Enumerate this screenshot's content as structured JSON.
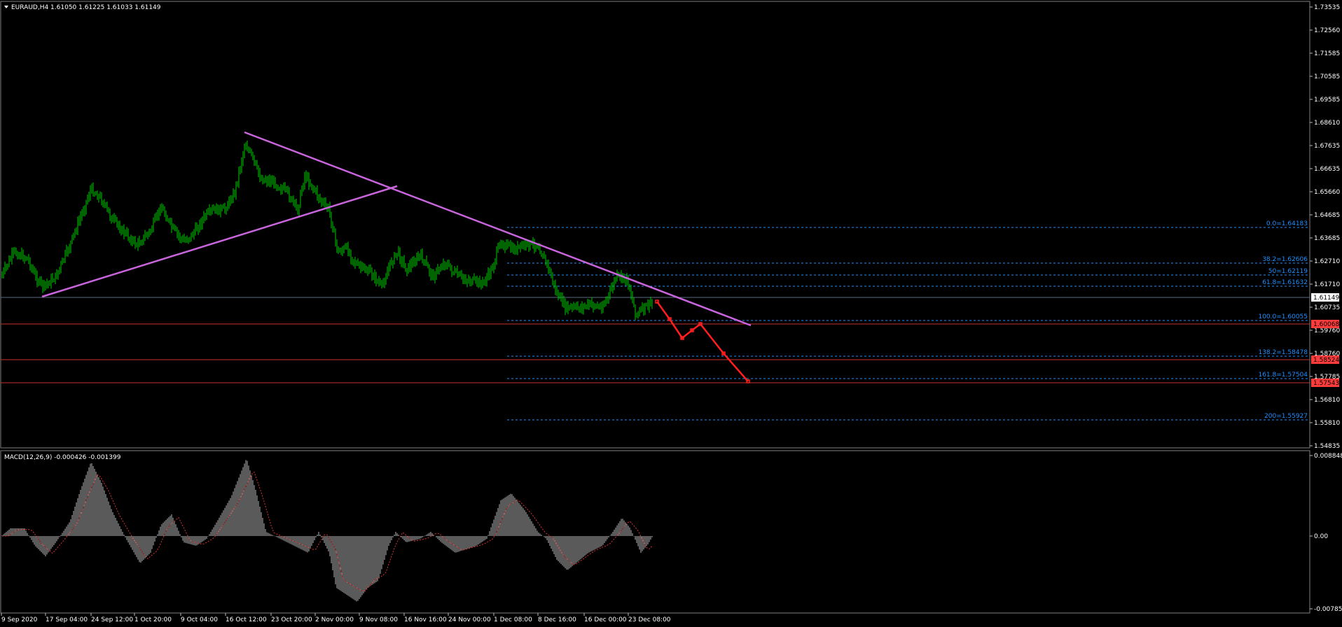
{
  "main_panel": {
    "title": "EURAUD,H4  1.61050 1.61225 1.61033 1.61149",
    "price_axis": [
      "1.73535",
      "1.72560",
      "1.71585",
      "1.70585",
      "1.69585",
      "1.68610",
      "1.67635",
      "1.66635",
      "1.65660",
      "1.64685",
      "1.63685",
      "1.62710",
      "1.61710",
      "1.60735",
      "1.59760",
      "1.58760",
      "1.57785",
      "1.56810",
      "1.55810",
      "1.54835"
    ],
    "current_price_label": "1.61149",
    "price_tags": [
      {
        "text": "1.60068",
        "color": "#ff3c3c"
      },
      {
        "text": "1.58524",
        "color": "#ff3c3c"
      },
      {
        "text": "1.57543",
        "color": "#ff3c3c"
      }
    ],
    "fib_labels": [
      "0.0=1.64183",
      "38.2=1.62606",
      "50=1.62119",
      "61.8=1.61632",
      "100.0=1.60055",
      "138.2=1.58478",
      "161.8=1.57504",
      "200=1.55927"
    ],
    "fib_color": "#1e90ff"
  },
  "macd_panel": {
    "title": "MACD(12,26,9) -0.000426 -0.001399",
    "axis": [
      "0.008848",
      "0.00",
      "-0.007852"
    ]
  },
  "time_axis": [
    "9 Sep 2020",
    "17 Sep 04:00",
    "24 Sep 12:00",
    "1 Oct 20:00",
    "9 Oct 04:00",
    "16 Oct 12:00",
    "23 Oct 20:00",
    "2 Nov 00:00",
    "9 Nov 08:00",
    "16 Nov 16:00",
    "24 Nov 00:00",
    "1 Dec 08:00",
    "8 Dec 16:00",
    "16 Dec 00:00",
    "23 Dec 08:00"
  ],
  "colors": {
    "candles": "#00c800",
    "trendline": "#c864dc",
    "projection": "#ff1e1e",
    "level_line": "#c83232",
    "current_line": "#5a6a80",
    "macd_hist": "#b4b4b4",
    "macd_signal": "#dc3232"
  }
}
